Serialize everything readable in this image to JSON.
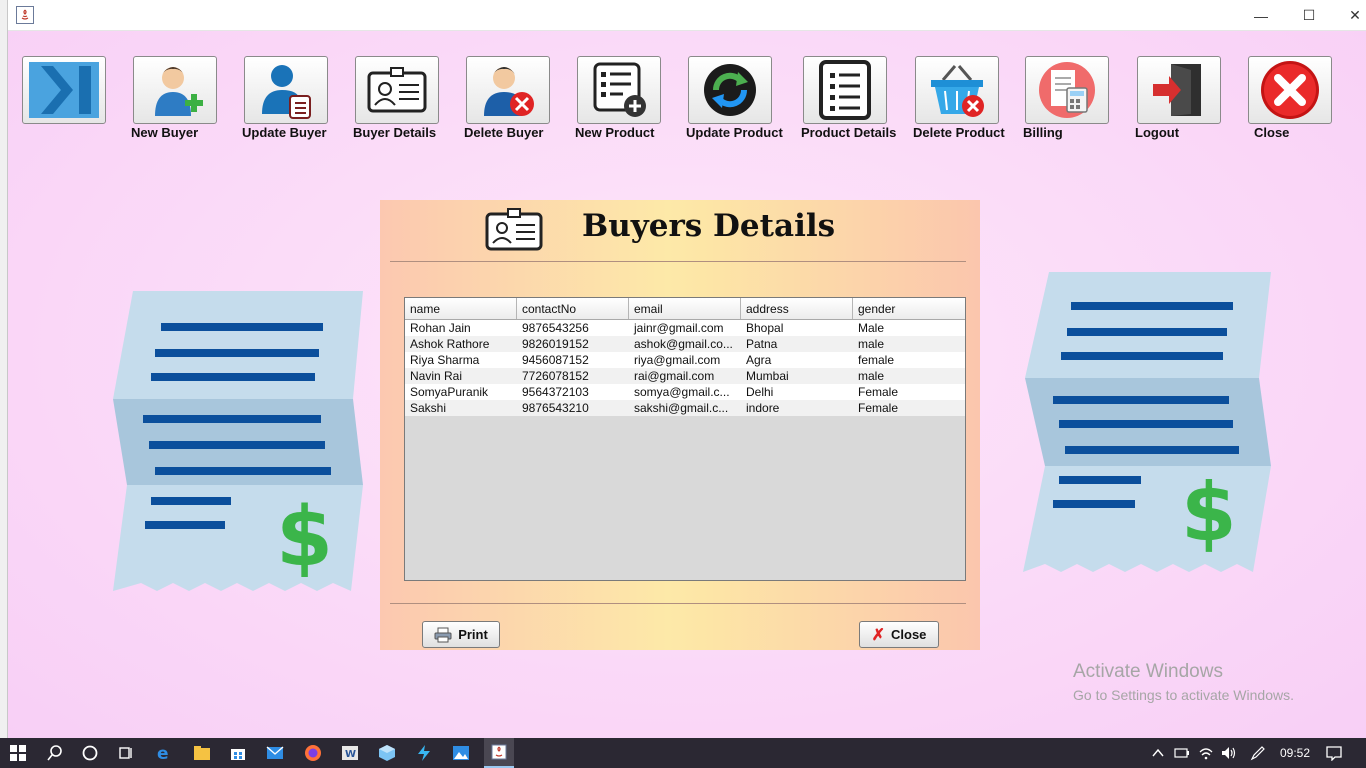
{
  "toolbar": {
    "items": [
      {
        "label": "",
        "icon": "collapse-arrow-icon"
      },
      {
        "label": "New Buyer",
        "icon": "add-user-icon"
      },
      {
        "label": "Update Buyer",
        "icon": "update-user-icon"
      },
      {
        "label": "Buyer Details",
        "icon": "id-card-icon"
      },
      {
        "label": "Delete Buyer",
        "icon": "delete-user-icon"
      },
      {
        "label": "New Product",
        "icon": "add-list-icon"
      },
      {
        "label": "Update Product",
        "icon": "refresh-icon"
      },
      {
        "label": "Product Details",
        "icon": "list-icon"
      },
      {
        "label": "Delete Product",
        "icon": "delete-basket-icon"
      },
      {
        "label": "Billing",
        "icon": "billing-icon"
      },
      {
        "label": "Logout",
        "icon": "logout-door-icon"
      },
      {
        "label": "Close",
        "icon": "close-red-icon"
      }
    ]
  },
  "dialog": {
    "title": "Buyers Details",
    "print_label": "Print",
    "close_label": "Close"
  },
  "table": {
    "headers": [
      "name",
      "contactNo",
      "email",
      "address",
      "gender"
    ],
    "rows": [
      [
        "Rohan Jain",
        "9876543256",
        "jainr@gmail.com",
        "Bhopal",
        "Male"
      ],
      [
        "Ashok Rathore",
        "9826019152",
        "ashok@gmail.co...",
        "Patna",
        "male"
      ],
      [
        "Riya Sharma",
        "9456087152",
        "riya@gmail.com",
        "Agra",
        "female"
      ],
      [
        "Navin Rai",
        "7726078152",
        "rai@gmail.com",
        "Mumbai",
        "male"
      ],
      [
        "SomyaPuranik",
        "9564372103",
        "somya@gmail.c...",
        "Delhi",
        "Female"
      ],
      [
        "Sakshi",
        "9876543210",
        "sakshi@gmail.c...",
        "indore",
        "Female"
      ]
    ]
  },
  "watermark": {
    "line1": "Activate Windows",
    "line2": "Go to Settings to activate Windows."
  },
  "taskbar": {
    "time": "09:52"
  },
  "colors": {
    "background": "#fbd9fa",
    "accent_blue": "#0b4f9c",
    "dollar_green": "#3bb54a"
  }
}
